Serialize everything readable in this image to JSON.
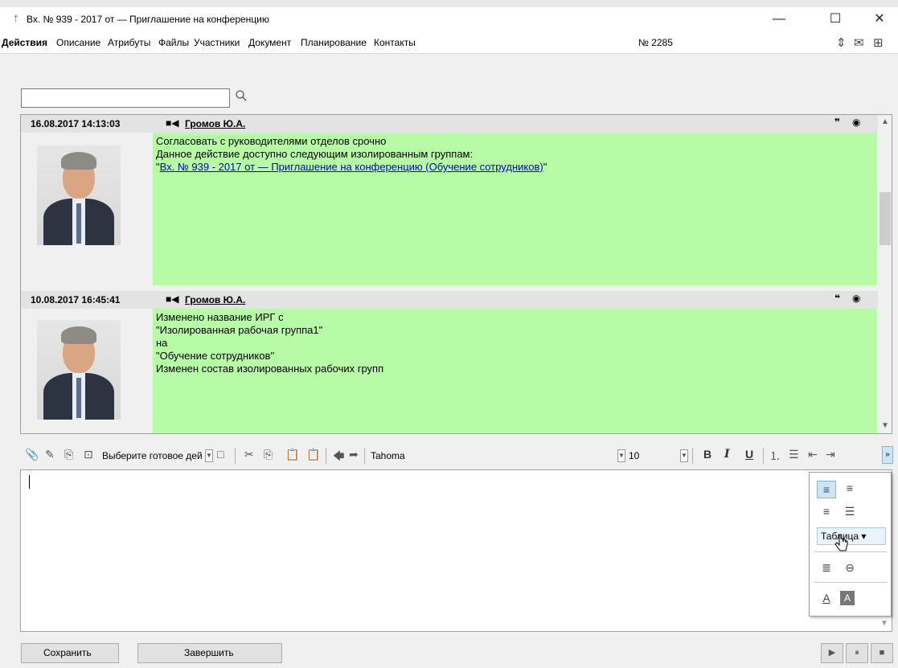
{
  "window": {
    "title": "Вх. № 939 - 2017 от — Приглашение на конференцию",
    "minimize": "—",
    "maximize": "☐",
    "close": "✕"
  },
  "menu": {
    "items": [
      {
        "label": "Действия",
        "active": true
      },
      {
        "label": "Описание"
      },
      {
        "label": "Атрибуты"
      },
      {
        "label": "Файлы"
      },
      {
        "label": "Участники"
      },
      {
        "label": "Документ"
      },
      {
        "label": "Планирование"
      },
      {
        "label": "Контакты"
      }
    ],
    "doc_number": "№ 2285",
    "icons": [
      "pin-arrows-icon",
      "envelope-icon",
      "org-chart-icon"
    ]
  },
  "search": {
    "value": "",
    "placeholder": ""
  },
  "entries": [
    {
      "date": "16.08.2017 14:13:03",
      "author": "Громов Ю.А.",
      "lines": [
        "Согласовать с руководителями отделов срочно",
        "",
        "Данное действие доступно следующим изолированным группам:"
      ],
      "link_prefix": "\"",
      "link": "Вх. № 939 - 2017 от — Приглашение на конференцию (Обучение сотрудников)",
      "link_suffix": "\""
    },
    {
      "date": "10.08.2017 16:45:41",
      "author": "Громов Ю.А.",
      "lines": [
        "Изменено название ИРГ с",
        "\"Изолированная рабочая группа1\"",
        "на",
        "\"Обучение сотрудников\"",
        "Изменен состав изолированных рабочих групп"
      ]
    }
  ],
  "toolbar": {
    "ready_action": "Выберите готовое дей",
    "font_name": "Tahoma",
    "font_size": "10",
    "bold": "B",
    "italic": "I",
    "underline": "U"
  },
  "format_popup": {
    "table_label": "Таблица ▾"
  },
  "footer": {
    "save": "Сохранить",
    "finish": "Завершить",
    "play": "▶",
    "pause": "⏸",
    "stop": "■"
  }
}
